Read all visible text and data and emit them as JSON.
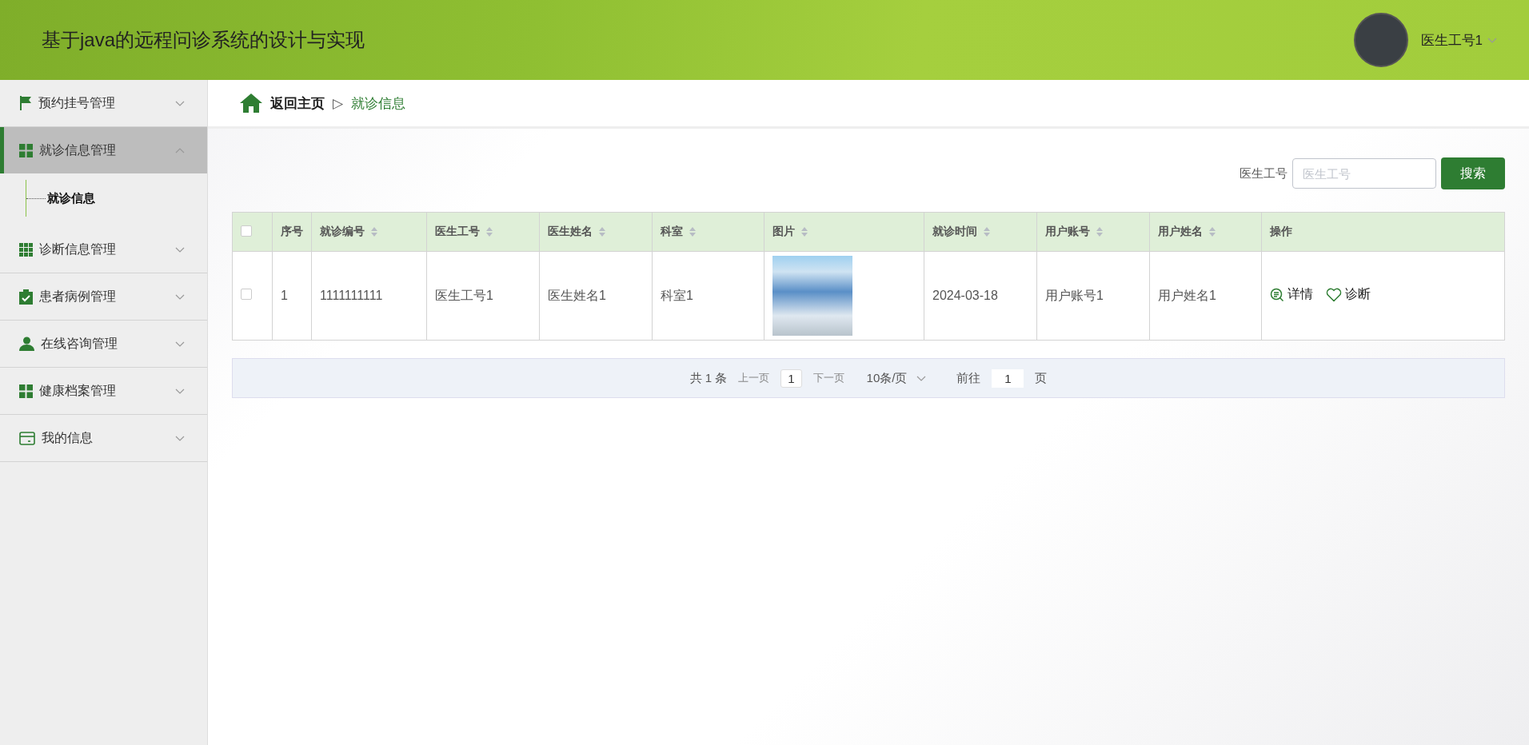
{
  "header": {
    "title": "基于java的远程问诊系统的设计与实现",
    "user": "医生工号1"
  },
  "sidebar": {
    "items": [
      {
        "label": "预约挂号管理",
        "kind": "flag",
        "expanded": false
      },
      {
        "label": "就诊信息管理",
        "kind": "grid",
        "expanded": true,
        "children": [
          {
            "label": "就诊信息",
            "selected": true
          }
        ]
      },
      {
        "label": "诊断信息管理",
        "kind": "grid9",
        "expanded": false
      },
      {
        "label": "患者病例管理",
        "kind": "clipboard",
        "expanded": false
      },
      {
        "label": "在线咨询管理",
        "kind": "person",
        "expanded": false
      },
      {
        "label": "健康档案管理",
        "kind": "grid",
        "expanded": false
      },
      {
        "label": "我的信息",
        "kind": "card",
        "expanded": false
      }
    ]
  },
  "breadcrumb": {
    "home": "返回主页",
    "separator": "▷",
    "current": "就诊信息"
  },
  "search": {
    "label": "医生工号",
    "placeholder": "医生工号",
    "button": "搜索"
  },
  "table": {
    "all_checked": false,
    "columns": [
      {
        "label": "序号",
        "sortable": false
      },
      {
        "label": "就诊编号",
        "sortable": true
      },
      {
        "label": "医生工号",
        "sortable": true
      },
      {
        "label": "医生姓名",
        "sortable": true
      },
      {
        "label": "科室",
        "sortable": true
      },
      {
        "label": "图片",
        "sortable": true
      },
      {
        "label": "就诊时间",
        "sortable": true
      },
      {
        "label": "用户账号",
        "sortable": true
      },
      {
        "label": "用户姓名",
        "sortable": true
      },
      {
        "label": "操作",
        "sortable": false
      }
    ],
    "rows": [
      {
        "checked": false,
        "cells": [
          "1",
          "1111111111",
          "医生工号1",
          "医生姓名1",
          "科室1",
          null,
          "2024-03-18",
          "用户账号1",
          "用户姓名1"
        ],
        "actions": [
          {
            "kind": "detail",
            "label": "详情"
          },
          {
            "kind": "diagnose",
            "label": "诊断"
          }
        ]
      }
    ]
  },
  "pagination": {
    "total": "共 1 条",
    "prev": "上一页",
    "page": "1",
    "next": "下一页",
    "page_size": "10条/页",
    "goto": "前往",
    "goto_value": "1",
    "page_suffix": "页"
  }
}
